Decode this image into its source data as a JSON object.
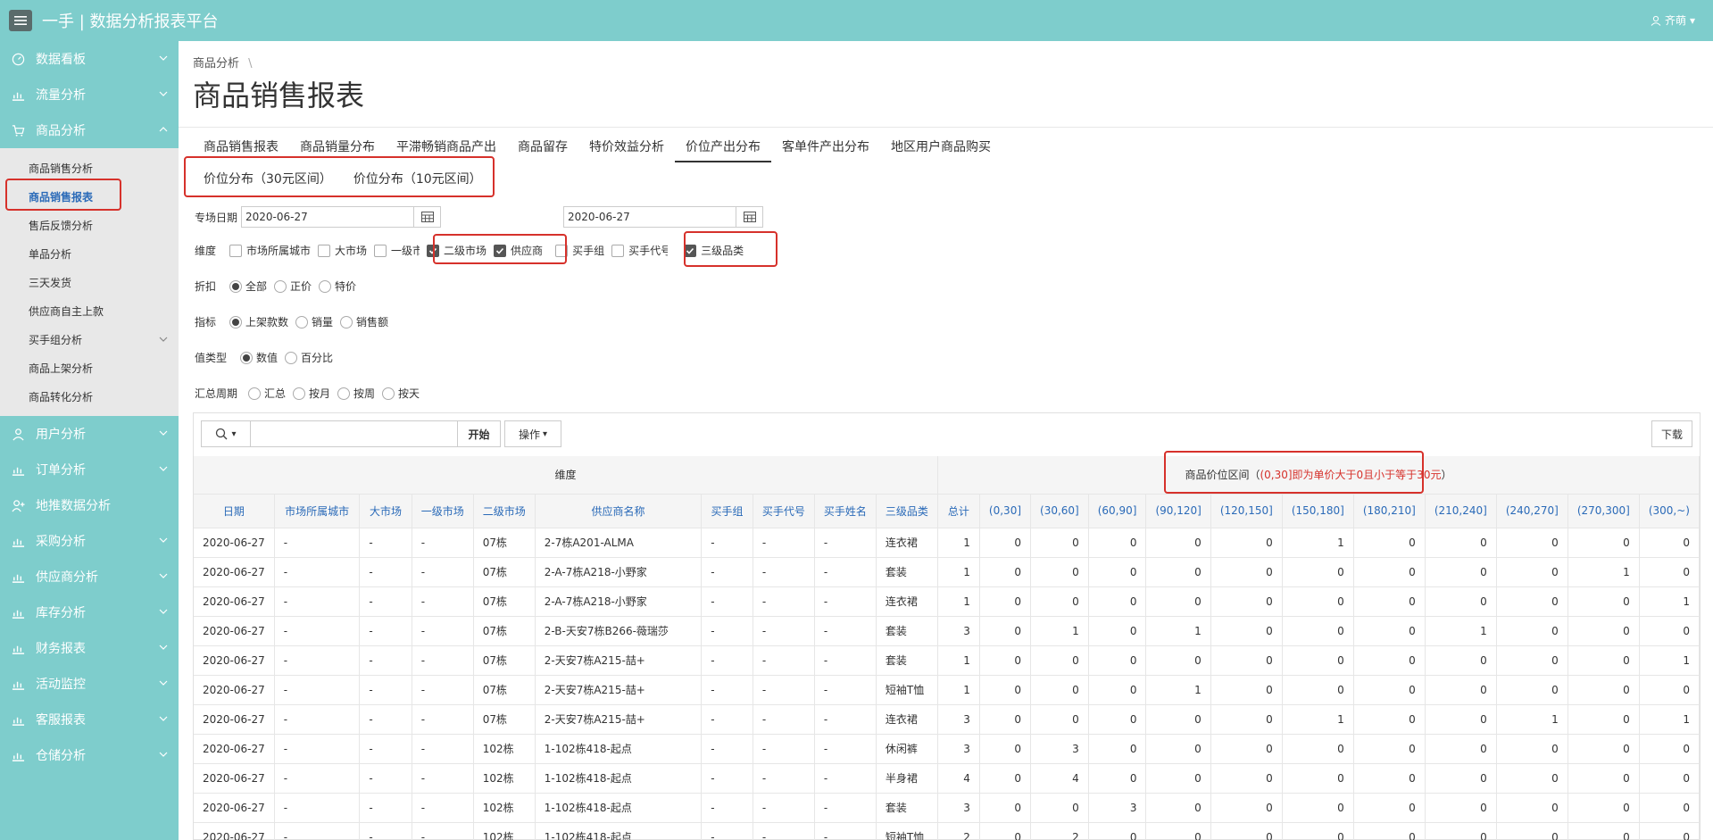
{
  "header": {
    "app_title": "一手 | 数据分析报表平台",
    "user": "齐萌"
  },
  "sidebar": {
    "items": [
      {
        "label": "数据看板",
        "icon": "dashboard-icon"
      },
      {
        "label": "流量分析",
        "icon": "chart-icon"
      },
      {
        "label": "商品分析",
        "icon": "cart-icon"
      }
    ],
    "sub_items": [
      {
        "label": "商品销售分析"
      },
      {
        "label": "商品销售报表"
      },
      {
        "label": "售后反馈分析"
      },
      {
        "label": "单品分析"
      },
      {
        "label": "三天发货"
      },
      {
        "label": "供应商自主上款"
      },
      {
        "label": "买手组分析"
      },
      {
        "label": "商品上架分析"
      },
      {
        "label": "商品转化分析"
      }
    ],
    "more_items": [
      {
        "label": "用户分析"
      },
      {
        "label": "订单分析"
      },
      {
        "label": "地推数据分析"
      },
      {
        "label": "采购分析"
      },
      {
        "label": "供应商分析"
      },
      {
        "label": "库存分析"
      },
      {
        "label": "财务报表"
      },
      {
        "label": "活动监控"
      },
      {
        "label": "客服报表"
      },
      {
        "label": "仓储分析"
      }
    ]
  },
  "breadcrumb": {
    "text": "商品分析",
    "sep": "\\"
  },
  "page_title": "商品销售报表",
  "tabs": [
    "商品销售报表",
    "商品销量分布",
    "平滞畅销商品产出",
    "商品留存",
    "特价效益分析",
    "价位产出分布",
    "客单件产出分布",
    "地区用户商品购买"
  ],
  "subtabs": [
    "价位分布（30元区间）",
    "价位分布（10元区间）"
  ],
  "form": {
    "date_label": "专场日期",
    "date_from": "2020-06-27",
    "date_to": "2020-06-27",
    "dim_label": "维度",
    "dims": [
      {
        "label": "市场所属城市",
        "checked": false
      },
      {
        "label": "大市场",
        "checked": false
      },
      {
        "label": "一级市场",
        "checked": false
      },
      {
        "label": "二级市场",
        "checked": true
      },
      {
        "label": "供应商",
        "checked": true
      },
      {
        "label": "买手组",
        "checked": false
      },
      {
        "label": "买手代号",
        "checked": false
      },
      {
        "label": "三级品类",
        "checked": true
      }
    ],
    "discount_label": "折扣",
    "discount": [
      "全部",
      "正价",
      "特价"
    ],
    "metric_label": "指标",
    "metric": [
      "上架款数",
      "销量",
      "销售额"
    ],
    "vtype_label": "值类型",
    "vtype": [
      "数值",
      "百分比"
    ],
    "period_label": "汇总周期",
    "period": [
      "汇总",
      "按月",
      "按周",
      "按天"
    ]
  },
  "toolbar": {
    "start": "开始",
    "ops": "操作",
    "download": "下载"
  },
  "table": {
    "group_dim": "维度",
    "group_price_prefix": "商品价位区间（",
    "group_price_red": "(0,30]即为单价大于0且小于等于30元",
    "group_price_suffix": "）",
    "columns": [
      "日期",
      "市场所属城市",
      "大市场",
      "一级市场",
      "二级市场",
      "供应商名称",
      "买手组",
      "买手代号",
      "买手姓名",
      "三级品类",
      "总计",
      "(0,30]",
      "(30,60]",
      "(60,90]",
      "(90,120]",
      "(120,150]",
      "(150,180]",
      "(180,210]",
      "(210,240]",
      "(240,270]",
      "(270,300]",
      "(300,~)"
    ],
    "rows": [
      [
        "2020-06-27",
        "-",
        "-",
        "-",
        "07栋",
        "2-7栋A201-ALMA",
        "-",
        "-",
        "-",
        "连衣裙",
        "1",
        "0",
        "0",
        "0",
        "0",
        "0",
        "1",
        "0",
        "0",
        "0",
        "0",
        "0"
      ],
      [
        "2020-06-27",
        "-",
        "-",
        "-",
        "07栋",
        "2-A-7栋A218-小野家",
        "-",
        "-",
        "-",
        "套装",
        "1",
        "0",
        "0",
        "0",
        "0",
        "0",
        "0",
        "0",
        "0",
        "0",
        "1",
        "0"
      ],
      [
        "2020-06-27",
        "-",
        "-",
        "-",
        "07栋",
        "2-A-7栋A218-小野家",
        "-",
        "-",
        "-",
        "连衣裙",
        "1",
        "0",
        "0",
        "0",
        "0",
        "0",
        "0",
        "0",
        "0",
        "0",
        "0",
        "1"
      ],
      [
        "2020-06-27",
        "-",
        "-",
        "-",
        "07栋",
        "2-B-天安7栋B266-薇瑞莎",
        "-",
        "-",
        "-",
        "套装",
        "3",
        "0",
        "1",
        "0",
        "1",
        "0",
        "0",
        "0",
        "1",
        "0",
        "0",
        "0"
      ],
      [
        "2020-06-27",
        "-",
        "-",
        "-",
        "07栋",
        "2-天安7栋A215-喆+",
        "-",
        "-",
        "-",
        "套装",
        "1",
        "0",
        "0",
        "0",
        "0",
        "0",
        "0",
        "0",
        "0",
        "0",
        "0",
        "1"
      ],
      [
        "2020-06-27",
        "-",
        "-",
        "-",
        "07栋",
        "2-天安7栋A215-喆+",
        "-",
        "-",
        "-",
        "短袖T恤",
        "1",
        "0",
        "0",
        "0",
        "1",
        "0",
        "0",
        "0",
        "0",
        "0",
        "0",
        "0"
      ],
      [
        "2020-06-27",
        "-",
        "-",
        "-",
        "07栋",
        "2-天安7栋A215-喆+",
        "-",
        "-",
        "-",
        "连衣裙",
        "3",
        "0",
        "0",
        "0",
        "0",
        "0",
        "1",
        "0",
        "0",
        "1",
        "0",
        "1"
      ],
      [
        "2020-06-27",
        "-",
        "-",
        "-",
        "102栋",
        "1-102栋418-起点",
        "-",
        "-",
        "-",
        "休闲裤",
        "3",
        "0",
        "3",
        "0",
        "0",
        "0",
        "0",
        "0",
        "0",
        "0",
        "0",
        "0"
      ],
      [
        "2020-06-27",
        "-",
        "-",
        "-",
        "102栋",
        "1-102栋418-起点",
        "-",
        "-",
        "-",
        "半身裙",
        "4",
        "0",
        "4",
        "0",
        "0",
        "0",
        "0",
        "0",
        "0",
        "0",
        "0",
        "0"
      ],
      [
        "2020-06-27",
        "-",
        "-",
        "-",
        "102栋",
        "1-102栋418-起点",
        "-",
        "-",
        "-",
        "套装",
        "3",
        "0",
        "0",
        "3",
        "0",
        "0",
        "0",
        "0",
        "0",
        "0",
        "0",
        "0"
      ],
      [
        "2020-06-27",
        "-",
        "-",
        "-",
        "102栋",
        "1-102栋418-起点",
        "-",
        "-",
        "-",
        "短袖T恤",
        "2",
        "0",
        "2",
        "0",
        "0",
        "0",
        "0",
        "0",
        "0",
        "0",
        "0",
        "0"
      ]
    ]
  },
  "colors": {
    "teal": "#7ecdcc",
    "highlight": "#d6312b",
    "link": "#2a6ab8"
  }
}
